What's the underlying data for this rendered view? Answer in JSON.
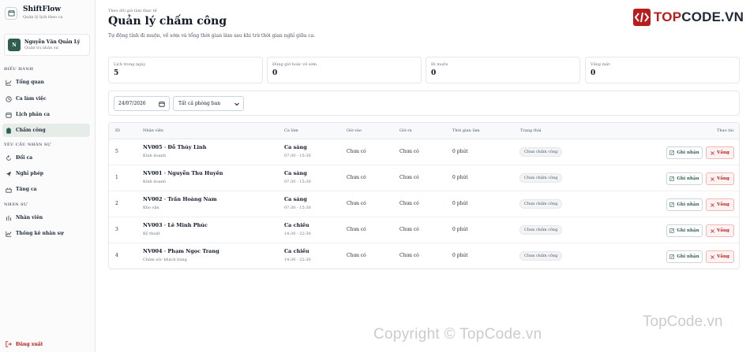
{
  "brand": {
    "name": "ShiftFlow",
    "tagline": "Quản lý lịch theo ca"
  },
  "user": {
    "initial": "N",
    "name": "Nguyễn Văn Quản Lý",
    "role": "Quản trị nhân sự"
  },
  "sidebar": {
    "sections": [
      {
        "label": "ĐIỀU HÀNH",
        "items": [
          {
            "label": "Tổng quan",
            "icon": "chart-line-icon"
          },
          {
            "label": "Ca làm việc",
            "icon": "clock-icon"
          },
          {
            "label": "Lịch phân ca",
            "icon": "calendar-icon"
          },
          {
            "label": "Chấm công",
            "icon": "clipboard-icon",
            "active": true
          }
        ]
      },
      {
        "label": "YÊU CẦU NHÂN SỰ",
        "items": [
          {
            "label": "Đổi ca",
            "icon": "swap-icon"
          },
          {
            "label": "Nghỉ phép",
            "icon": "send-icon"
          },
          {
            "label": "Tăng ca",
            "icon": "clock-plus-icon"
          }
        ]
      },
      {
        "label": "NHÂN SỰ",
        "items": [
          {
            "label": "Nhân viên",
            "icon": "users-icon"
          },
          {
            "label": "Thống kê nhân sự",
            "icon": "stats-icon"
          }
        ]
      }
    ],
    "logout": "Đăng xuất"
  },
  "header": {
    "eyebrow": "Theo dõi giờ làm thực tế",
    "title": "Quản lý chấm công",
    "subtitle": "Tự động tính đi muộn, về sớm và tổng thời gian làm sau khi trừ thời gian nghỉ giữa ca."
  },
  "logo": {
    "prefix": "TOP",
    "suffix": "CODE.VN"
  },
  "stats": [
    {
      "label": "Lịch trong ngày",
      "value": "5"
    },
    {
      "label": "Đúng giờ hoặc về sớm",
      "value": "0"
    },
    {
      "label": "Đi muộn",
      "value": "0"
    },
    {
      "label": "Vắng mặt",
      "value": "0"
    }
  ],
  "filters": {
    "date": "24/07/2026",
    "department": "Tất cả phòng ban"
  },
  "table": {
    "headers": [
      "ID",
      "Nhân viên",
      "Ca làm",
      "Giờ vào",
      "Giờ ra",
      "Thời gian làm",
      "Trạng thái",
      "Thao tác"
    ],
    "rows": [
      {
        "id": "5",
        "employee": "NV005 · Đỗ Thùy Linh",
        "dept": "Kinh doanh",
        "shift": "Ca sáng",
        "shift_time": "07:30 - 15:30",
        "check_in": "Chưa có",
        "check_out": "Chưa có",
        "duration": "0 phút",
        "status": "Chưa chấm công"
      },
      {
        "id": "1",
        "employee": "NV001 · Nguyễn Thu Huyền",
        "dept": "Kinh doanh",
        "shift": "Ca sáng",
        "shift_time": "07:30 - 15:30",
        "check_in": "Chưa có",
        "check_out": "Chưa có",
        "duration": "0 phút",
        "status": "Chưa chấm công"
      },
      {
        "id": "2",
        "employee": "NV002 · Trần Hoàng Nam",
        "dept": "Kho vận",
        "shift": "Ca sáng",
        "shift_time": "07:30 - 15:30",
        "check_in": "Chưa có",
        "check_out": "Chưa có",
        "duration": "0 phút",
        "status": "Chưa chấm công"
      },
      {
        "id": "3",
        "employee": "NV003 · Lê Minh Phúc",
        "dept": "Kỹ thuật",
        "shift": "Ca chiều",
        "shift_time": "14:30 - 22:30",
        "check_in": "Chưa có",
        "check_out": "Chưa có",
        "duration": "0 phút",
        "status": "Chưa chấm công"
      },
      {
        "id": "4",
        "employee": "NV004 · Phạm Ngọc Trang",
        "dept": "Chăm sóc khách hàng",
        "shift": "Ca chiều",
        "shift_time": "14:30 - 22:30",
        "check_in": "Chưa có",
        "check_out": "Chưa có",
        "duration": "0 phút",
        "status": "Chưa chấm công"
      }
    ],
    "record_label": "Ghi nhận",
    "absent_label": "Vắng"
  },
  "watermark": {
    "main": "Copyright © TopCode.vn",
    "side": "TopCode.vn"
  },
  "colors": {
    "accent": "#2f5d50",
    "danger": "#b91c1c",
    "active_bg": "#e6ede9"
  }
}
